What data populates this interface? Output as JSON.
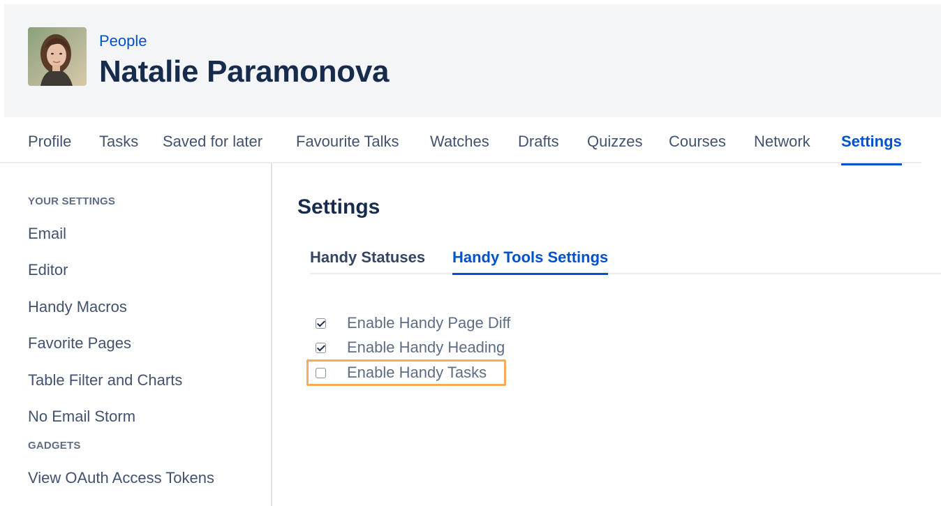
{
  "header": {
    "breadcrumb": "People",
    "title": "Natalie Paramonova"
  },
  "nav": {
    "tabs": [
      {
        "label": "Profile"
      },
      {
        "label": "Tasks"
      },
      {
        "label": "Saved for later"
      },
      {
        "label": "Favourite Talks"
      },
      {
        "label": "Watches"
      },
      {
        "label": "Drafts"
      },
      {
        "label": "Quizzes"
      },
      {
        "label": "Courses"
      },
      {
        "label": "Network"
      },
      {
        "label": "Settings"
      }
    ],
    "active_tab": "Settings"
  },
  "sidebar": {
    "sections": [
      {
        "label": "YOUR SETTINGS",
        "items": [
          "Email",
          "Editor",
          "Handy Macros",
          "Favorite Pages",
          "Table Filter and Charts",
          "No Email Storm"
        ]
      },
      {
        "label": "GADGETS",
        "items": [
          "View OAuth Access Tokens"
        ]
      }
    ]
  },
  "main": {
    "title": "Settings",
    "subtabs": [
      {
        "label": "Handy Statuses"
      },
      {
        "label": "Handy Tools Settings"
      }
    ],
    "active_subtab": "Handy Tools Settings",
    "options": [
      {
        "label": "Enable Handy Page Diff",
        "checked": true
      },
      {
        "label": "Enable Handy Heading",
        "checked": true
      },
      {
        "label": "Enable Handy Tasks",
        "checked": false
      }
    ]
  },
  "colors": {
    "accent": "#0052cc",
    "header_bg": "#f4f5f7",
    "highlight": "#f7ab5b"
  }
}
